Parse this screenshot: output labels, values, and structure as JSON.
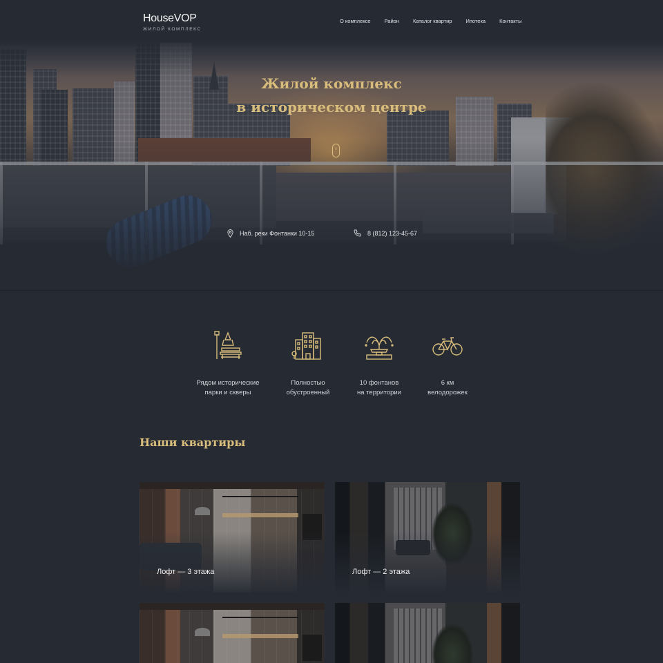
{
  "header": {
    "logo_title": "HouseVOP",
    "logo_subtitle": "ЖИЛОЙ КОМПЛЕКС",
    "nav": [
      {
        "label": "О комплексе"
      },
      {
        "label": "Район"
      },
      {
        "label": "Каталог квартир"
      },
      {
        "label": "Ипотека"
      },
      {
        "label": "Контакты"
      }
    ]
  },
  "hero": {
    "title_line1": "Жилой комплекс",
    "title_line2": "в историческом центре",
    "scroll_icon": "mouse-scroll-icon",
    "address": "Наб. реки Фонтанки 10-15",
    "address_icon": "location-pin-icon",
    "phone": "8 (812) 123-45-67",
    "phone_icon": "phone-icon"
  },
  "features": [
    {
      "icon": "park-bench-icon",
      "text": "Рядом исторические\nпарки и скверы"
    },
    {
      "icon": "buildings-icon",
      "text": "Полностью\nобустроенный"
    },
    {
      "icon": "fountain-icon",
      "text": "10 фонтанов\nна территории"
    },
    {
      "icon": "bicycle-icon",
      "text": "6 км\nвелодорожек"
    }
  ],
  "apartments": {
    "title": "Наши квартиры",
    "cards": [
      {
        "label": "Лофт — 3 этажа"
      },
      {
        "label": "Лофт — 2 этажа"
      },
      {
        "label": ""
      },
      {
        "label": ""
      }
    ]
  },
  "colors": {
    "background": "#252a33",
    "accent_gold": "#d9bd7c"
  }
}
